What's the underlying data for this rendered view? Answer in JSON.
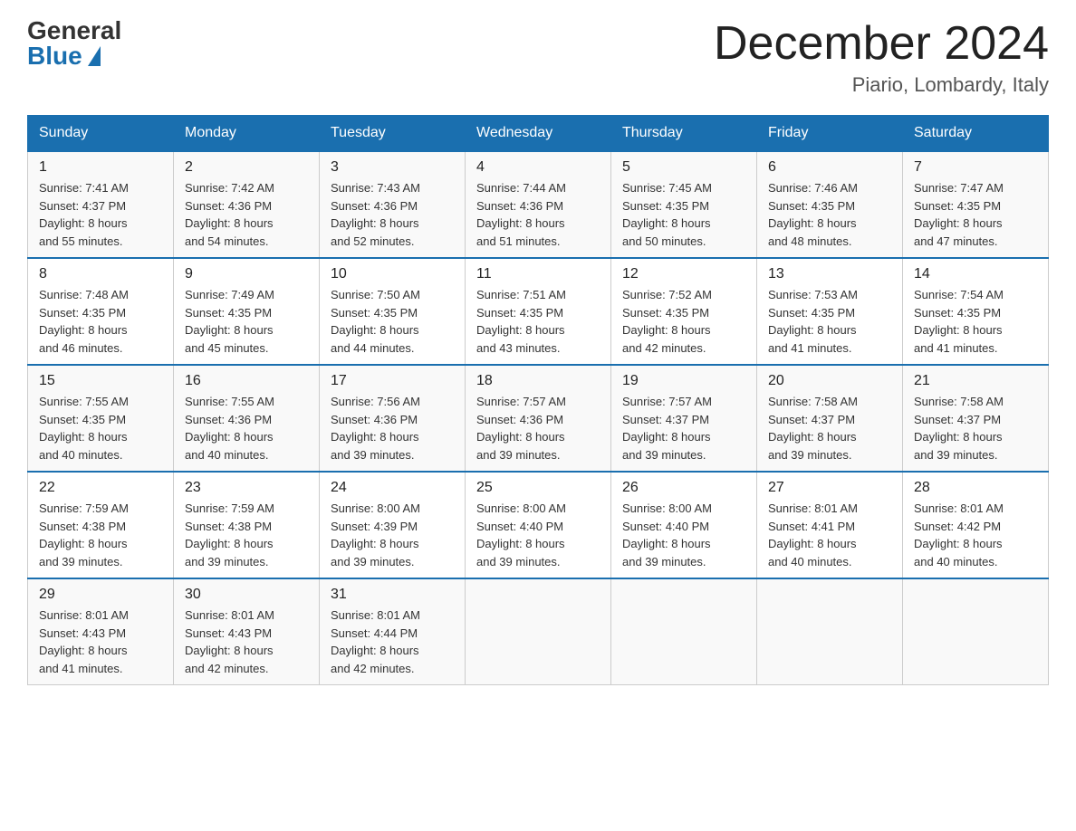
{
  "header": {
    "logo_general": "General",
    "logo_blue": "Blue",
    "month_title": "December 2024",
    "location": "Piario, Lombardy, Italy"
  },
  "days_of_week": [
    "Sunday",
    "Monday",
    "Tuesday",
    "Wednesday",
    "Thursday",
    "Friday",
    "Saturday"
  ],
  "weeks": [
    [
      {
        "day": "1",
        "sunrise": "7:41 AM",
        "sunset": "4:37 PM",
        "daylight": "8 hours and 55 minutes."
      },
      {
        "day": "2",
        "sunrise": "7:42 AM",
        "sunset": "4:36 PM",
        "daylight": "8 hours and 54 minutes."
      },
      {
        "day": "3",
        "sunrise": "7:43 AM",
        "sunset": "4:36 PM",
        "daylight": "8 hours and 52 minutes."
      },
      {
        "day": "4",
        "sunrise": "7:44 AM",
        "sunset": "4:36 PM",
        "daylight": "8 hours and 51 minutes."
      },
      {
        "day": "5",
        "sunrise": "7:45 AM",
        "sunset": "4:35 PM",
        "daylight": "8 hours and 50 minutes."
      },
      {
        "day": "6",
        "sunrise": "7:46 AM",
        "sunset": "4:35 PM",
        "daylight": "8 hours and 48 minutes."
      },
      {
        "day": "7",
        "sunrise": "7:47 AM",
        "sunset": "4:35 PM",
        "daylight": "8 hours and 47 minutes."
      }
    ],
    [
      {
        "day": "8",
        "sunrise": "7:48 AM",
        "sunset": "4:35 PM",
        "daylight": "8 hours and 46 minutes."
      },
      {
        "day": "9",
        "sunrise": "7:49 AM",
        "sunset": "4:35 PM",
        "daylight": "8 hours and 45 minutes."
      },
      {
        "day": "10",
        "sunrise": "7:50 AM",
        "sunset": "4:35 PM",
        "daylight": "8 hours and 44 minutes."
      },
      {
        "day": "11",
        "sunrise": "7:51 AM",
        "sunset": "4:35 PM",
        "daylight": "8 hours and 43 minutes."
      },
      {
        "day": "12",
        "sunrise": "7:52 AM",
        "sunset": "4:35 PM",
        "daylight": "8 hours and 42 minutes."
      },
      {
        "day": "13",
        "sunrise": "7:53 AM",
        "sunset": "4:35 PM",
        "daylight": "8 hours and 41 minutes."
      },
      {
        "day": "14",
        "sunrise": "7:54 AM",
        "sunset": "4:35 PM",
        "daylight": "8 hours and 41 minutes."
      }
    ],
    [
      {
        "day": "15",
        "sunrise": "7:55 AM",
        "sunset": "4:35 PM",
        "daylight": "8 hours and 40 minutes."
      },
      {
        "day": "16",
        "sunrise": "7:55 AM",
        "sunset": "4:36 PM",
        "daylight": "8 hours and 40 minutes."
      },
      {
        "day": "17",
        "sunrise": "7:56 AM",
        "sunset": "4:36 PM",
        "daylight": "8 hours and 39 minutes."
      },
      {
        "day": "18",
        "sunrise": "7:57 AM",
        "sunset": "4:36 PM",
        "daylight": "8 hours and 39 minutes."
      },
      {
        "day": "19",
        "sunrise": "7:57 AM",
        "sunset": "4:37 PM",
        "daylight": "8 hours and 39 minutes."
      },
      {
        "day": "20",
        "sunrise": "7:58 AM",
        "sunset": "4:37 PM",
        "daylight": "8 hours and 39 minutes."
      },
      {
        "day": "21",
        "sunrise": "7:58 AM",
        "sunset": "4:37 PM",
        "daylight": "8 hours and 39 minutes."
      }
    ],
    [
      {
        "day": "22",
        "sunrise": "7:59 AM",
        "sunset": "4:38 PM",
        "daylight": "8 hours and 39 minutes."
      },
      {
        "day": "23",
        "sunrise": "7:59 AM",
        "sunset": "4:38 PM",
        "daylight": "8 hours and 39 minutes."
      },
      {
        "day": "24",
        "sunrise": "8:00 AM",
        "sunset": "4:39 PM",
        "daylight": "8 hours and 39 minutes."
      },
      {
        "day": "25",
        "sunrise": "8:00 AM",
        "sunset": "4:40 PM",
        "daylight": "8 hours and 39 minutes."
      },
      {
        "day": "26",
        "sunrise": "8:00 AM",
        "sunset": "4:40 PM",
        "daylight": "8 hours and 39 minutes."
      },
      {
        "day": "27",
        "sunrise": "8:01 AM",
        "sunset": "4:41 PM",
        "daylight": "8 hours and 40 minutes."
      },
      {
        "day": "28",
        "sunrise": "8:01 AM",
        "sunset": "4:42 PM",
        "daylight": "8 hours and 40 minutes."
      }
    ],
    [
      {
        "day": "29",
        "sunrise": "8:01 AM",
        "sunset": "4:43 PM",
        "daylight": "8 hours and 41 minutes."
      },
      {
        "day": "30",
        "sunrise": "8:01 AM",
        "sunset": "4:43 PM",
        "daylight": "8 hours and 42 minutes."
      },
      {
        "day": "31",
        "sunrise": "8:01 AM",
        "sunset": "4:44 PM",
        "daylight": "8 hours and 42 minutes."
      },
      null,
      null,
      null,
      null
    ]
  ],
  "labels": {
    "sunrise": "Sunrise:",
    "sunset": "Sunset:",
    "daylight": "Daylight:"
  }
}
